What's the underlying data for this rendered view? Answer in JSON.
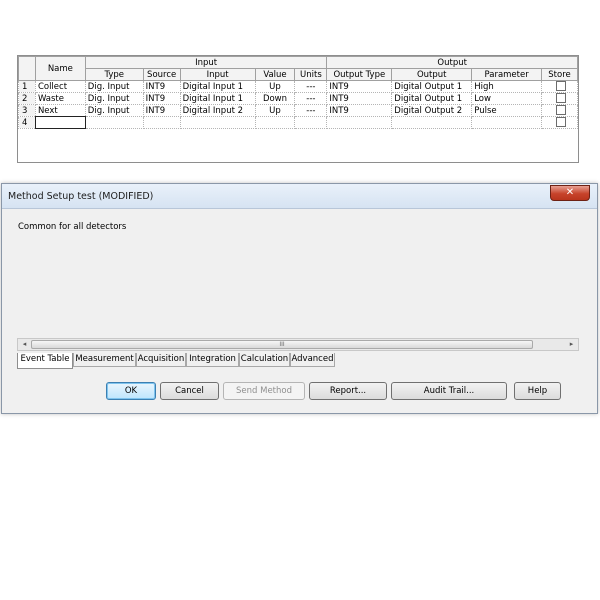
{
  "window": {
    "title": "Method Setup test (MODIFIED)",
    "close_glyph": "✕"
  },
  "group_label": "Common for all detectors",
  "table": {
    "group_headers": {
      "name": "Name",
      "input": "Input",
      "output": "Output"
    },
    "columns": [
      "Type",
      "Source",
      "Input",
      "Value",
      "Units",
      "Output Type",
      "Output",
      "Parameter",
      "Store"
    ],
    "rows": [
      {
        "num": "1",
        "name": "Collect",
        "type": "Dig. Input",
        "source": "INT9",
        "input": "Digital Input 1",
        "value": "Up",
        "units": "---",
        "output_type": "INT9",
        "output": "Digital Output 1",
        "parameter": "High"
      },
      {
        "num": "2",
        "name": "Waste",
        "type": "Dig. Input",
        "source": "INT9",
        "input": "Digital Input 1",
        "value": "Down",
        "units": "---",
        "output_type": "INT9",
        "output": "Digital Output 1",
        "parameter": "Low"
      },
      {
        "num": "3",
        "name": "Next",
        "type": "Dig. Input",
        "source": "INT9",
        "input": "Digital Input 2",
        "value": "Up",
        "units": "---",
        "output_type": "INT9",
        "output": "Digital Output 2",
        "parameter": "Pulse"
      },
      {
        "num": "4",
        "name": "",
        "type": "",
        "source": "",
        "input": "",
        "value": "",
        "units": "",
        "output_type": "",
        "output": "",
        "parameter": ""
      }
    ]
  },
  "scrollbar": {
    "left_arrow": "◂",
    "right_arrow": "▸",
    "grip": "III"
  },
  "tabs": [
    "Event Table",
    "Measurement",
    "Acquisition",
    "Integration",
    "Calculation",
    "Advanced"
  ],
  "buttons": {
    "ok": "OK",
    "cancel": "Cancel",
    "send_method": "Send Method",
    "report": "Report...",
    "audit_trail": "Audit Trail...",
    "help": "Help"
  },
  "colors": {
    "title_bar": "#d6e3f2",
    "close_button": "#c7432b",
    "default_button": "#3c7fb1"
  }
}
